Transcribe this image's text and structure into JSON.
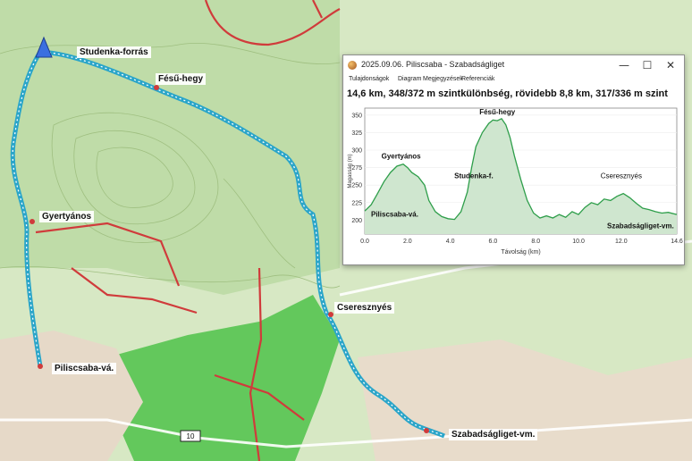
{
  "map": {
    "labels": [
      {
        "id": "studenka-forras",
        "text": "Studenka-forrás"
      },
      {
        "id": "fesu-hegy",
        "text": "Fésű-hegy"
      },
      {
        "id": "gyertyanos",
        "text": "Gyertyános"
      },
      {
        "id": "piliscsaba-va",
        "text": "Piliscsaba-vá."
      },
      {
        "id": "cseresznyes",
        "text": "Cseresznyés"
      },
      {
        "id": "szabadsagliget-vm",
        "text": "Szabadságliget-vm."
      }
    ],
    "road_number": "10",
    "colors": {
      "route": "#2aa5c9",
      "route_dots": "#ffffff",
      "trail_red": "#d03b3b",
      "forest": "#4fc24a",
      "start_marker": "#3a6fe0"
    }
  },
  "window": {
    "title": "2025.09.06. Piliscsaba - Szabadságliget",
    "controls": {
      "minimize": "—",
      "maximize": "☐",
      "close": "✕"
    },
    "menu": [
      "Tulajdonságok",
      "Diagram",
      "Megjegyzések",
      "Referenciák"
    ],
    "summary": "14,6 km, 348/372 m szintkülönbség, rövidebb 8,8 km, 317/336 m szint"
  },
  "chart_data": {
    "type": "area",
    "xlabel": "Távolság  (km)",
    "ylabel": "Magasság (m)",
    "xlim": [
      0,
      14.6
    ],
    "ylim": [
      180,
      360
    ],
    "xticks": [
      "0.0",
      "2.0",
      "4.0",
      "6.0",
      "8.0",
      "10.0",
      "12.0",
      "14.6"
    ],
    "yticks": [
      "200",
      "225",
      "250",
      "275",
      "300",
      "325",
      "350"
    ],
    "fill_color": "#cfe6cf",
    "line_color": "#2e9e4a",
    "annotations": [
      {
        "text": "Fésű-hegy",
        "x": 6.2,
        "y": 351
      },
      {
        "text": "Gyertyános",
        "x": 1.7,
        "y": 288
      },
      {
        "text": "Studenka-f.",
        "x": 5.1,
        "y": 260
      },
      {
        "text": "Piliscsaba-vá.",
        "x": 1.4,
        "y": 205
      },
      {
        "text": "Cseresznyés",
        "x": 12.0,
        "y": 260
      },
      {
        "text": "Szabadságliget-vm.",
        "x": 12.9,
        "y": 188
      }
    ],
    "x": [
      0,
      0.3,
      0.6,
      0.9,
      1.2,
      1.5,
      1.8,
      2.0,
      2.2,
      2.5,
      2.8,
      3.0,
      3.3,
      3.6,
      3.9,
      4.2,
      4.5,
      4.8,
      5.0,
      5.2,
      5.5,
      5.8,
      6.0,
      6.2,
      6.4,
      6.6,
      6.8,
      7.0,
      7.3,
      7.6,
      7.9,
      8.2,
      8.5,
      8.8,
      9.1,
      9.4,
      9.7,
      10.0,
      10.3,
      10.6,
      10.9,
      11.2,
      11.5,
      11.8,
      12.1,
      12.4,
      12.7,
      13.0,
      13.3,
      13.6,
      13.9,
      14.2,
      14.6
    ],
    "y": [
      213,
      222,
      238,
      255,
      268,
      277,
      280,
      275,
      268,
      262,
      250,
      228,
      212,
      205,
      202,
      201,
      212,
      240,
      275,
      305,
      325,
      338,
      343,
      342,
      345,
      336,
      318,
      292,
      258,
      228,
      210,
      203,
      206,
      203,
      208,
      204,
      212,
      208,
      218,
      225,
      222,
      230,
      228,
      234,
      238,
      232,
      224,
      217,
      215,
      212,
      210,
      211,
      208
    ]
  }
}
